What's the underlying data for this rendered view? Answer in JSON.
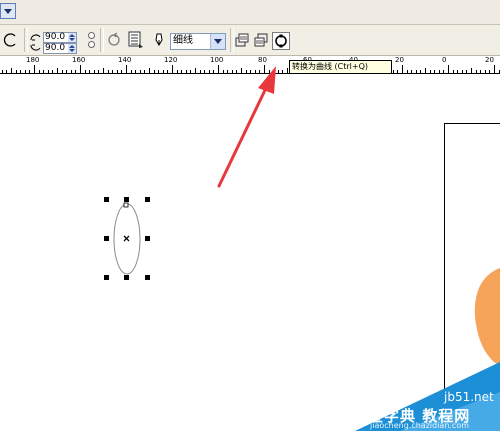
{
  "property_bar": {
    "start_angle": "90.0",
    "end_angle": "90.0",
    "outline_width": "细线"
  },
  "ruler": {
    "labels": [
      "180",
      "160",
      "140",
      "120",
      "100",
      "80",
      "60",
      "40",
      "20",
      "0",
      "20"
    ]
  },
  "tooltip": {
    "text": "转换为曲线 (Ctrl+Q)"
  },
  "watermark": {
    "site": "jb51.net",
    "brand": "查字典 教程网",
    "domain": "jiaocheng.chazidian.com"
  },
  "colors": {
    "annotation_arrow": "#e8383d",
    "watermark_blue": "#1d8fd6",
    "orange_shape": "#f5a45a"
  }
}
